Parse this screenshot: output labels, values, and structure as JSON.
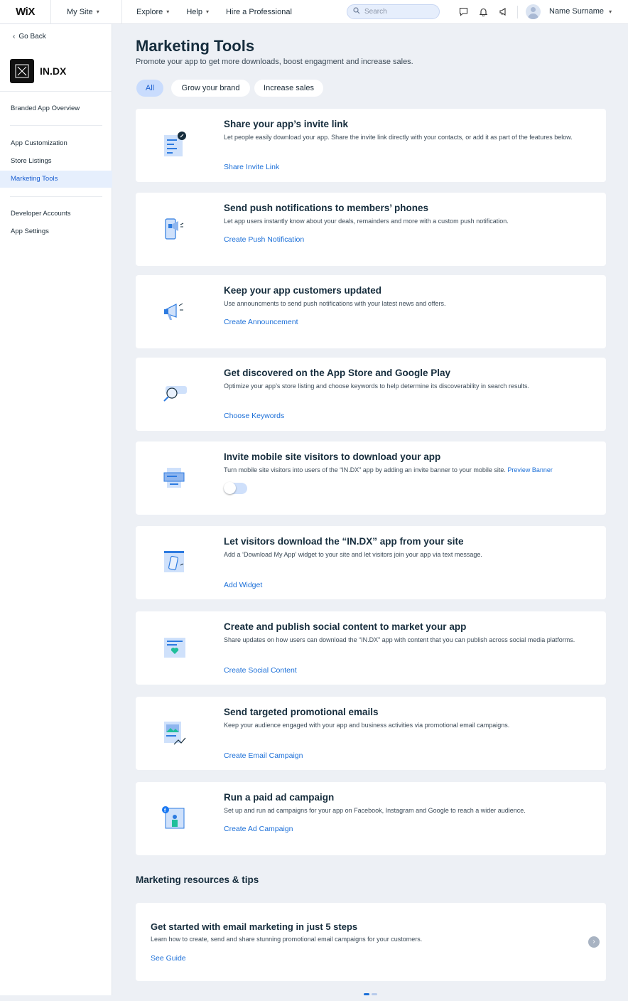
{
  "topbar": {
    "logo": "WiX",
    "site_menu": "My Site",
    "nav": [
      "Explore",
      "Help",
      "Hire a Professional"
    ],
    "search_placeholder": "Search",
    "user_name": "Name Surname"
  },
  "sidebar": {
    "go_back": "Go Back",
    "brand_name": "IN.DX",
    "overview": "Branded App Overview",
    "group1": [
      "App Customization",
      "Store Listings",
      "Marketing Tools"
    ],
    "group2": [
      "Developer Accounts",
      "App Settings"
    ],
    "active_item": "Marketing Tools"
  },
  "main": {
    "title": "Marketing Tools",
    "subtitle": "Promote your app to get more downloads, boost engagment and increase sales.",
    "filters": [
      "All",
      "Grow your brand",
      "Increase sales"
    ],
    "active_filter": "All",
    "cards": [
      {
        "icon": "invite-link-icon",
        "title": "Share your app’s invite link",
        "desc": "Let people easily download your app. Share the invite link directly with your contacts, or add it as part of the features below.",
        "link": "Share Invite Link"
      },
      {
        "icon": "push-notification-icon",
        "title": "Send push notifications to members’ phones",
        "desc": "Let app users instantly know about your deals, remainders and more with a custom push notification.",
        "link": "Create Push Notification"
      },
      {
        "icon": "megaphone-icon",
        "title": "Keep your app customers updated",
        "desc": "Use announcments to send push notifications with your latest news and offers.",
        "link": "Create Announcement"
      },
      {
        "icon": "magnifier-icon",
        "title": "Get discovered on the App Store and Google Play",
        "desc": "Optimize your app’s store listing and choose keywords to help determine its discoverability in search results.",
        "link": "Choose Keywords"
      },
      {
        "icon": "banner-icon",
        "title": "Invite mobile site visitors to download your app",
        "desc": "Turn mobile site visitors into users of the “IN.DX” app by adding an invite banner to your mobile site.",
        "inline_link": "Preview Banner",
        "toggle_on": false
      },
      {
        "icon": "widget-phone-icon",
        "title": "Let visitors download the “IN.DX” app from your site",
        "desc": "Add a ‘Download My App’ widget to your site and let visitors join your app via text message.",
        "link": "Add Widget"
      },
      {
        "icon": "social-heart-icon",
        "title": "Create and publish social content to market your app",
        "desc": " Share updates on how users can download the “IN.DX” app with content that you can publish across social media platforms.",
        "link": "Create Social Content"
      },
      {
        "icon": "email-campaign-icon",
        "title": "Send targeted promotional emails",
        "desc": "Keep your audience engaged with your app and business activities via promotional email campaigns.",
        "link": "Create Email Campaign"
      },
      {
        "icon": "ad-campaign-icon",
        "title": "Run a paid ad campaign",
        "desc": "Set up and run ad campaigns for your app on Facebook, Instagram and Google to reach a wider audience.",
        "link": "Create Ad Campaign"
      }
    ],
    "resources_title": "Marketing resources & tips",
    "resource": {
      "title": "Get started with email marketing in just 5 steps",
      "desc": "Learn how to create, send and share stunning promotional email campaigns for your customers.",
      "link": "See Guide"
    },
    "carousel_pages": 2,
    "carousel_active": 1
  },
  "colors": {
    "accent": "#1b6fd8",
    "active_bg": "#e6effd",
    "chip_active": "#c9dcfd",
    "page_bg": "#edf0f5"
  }
}
